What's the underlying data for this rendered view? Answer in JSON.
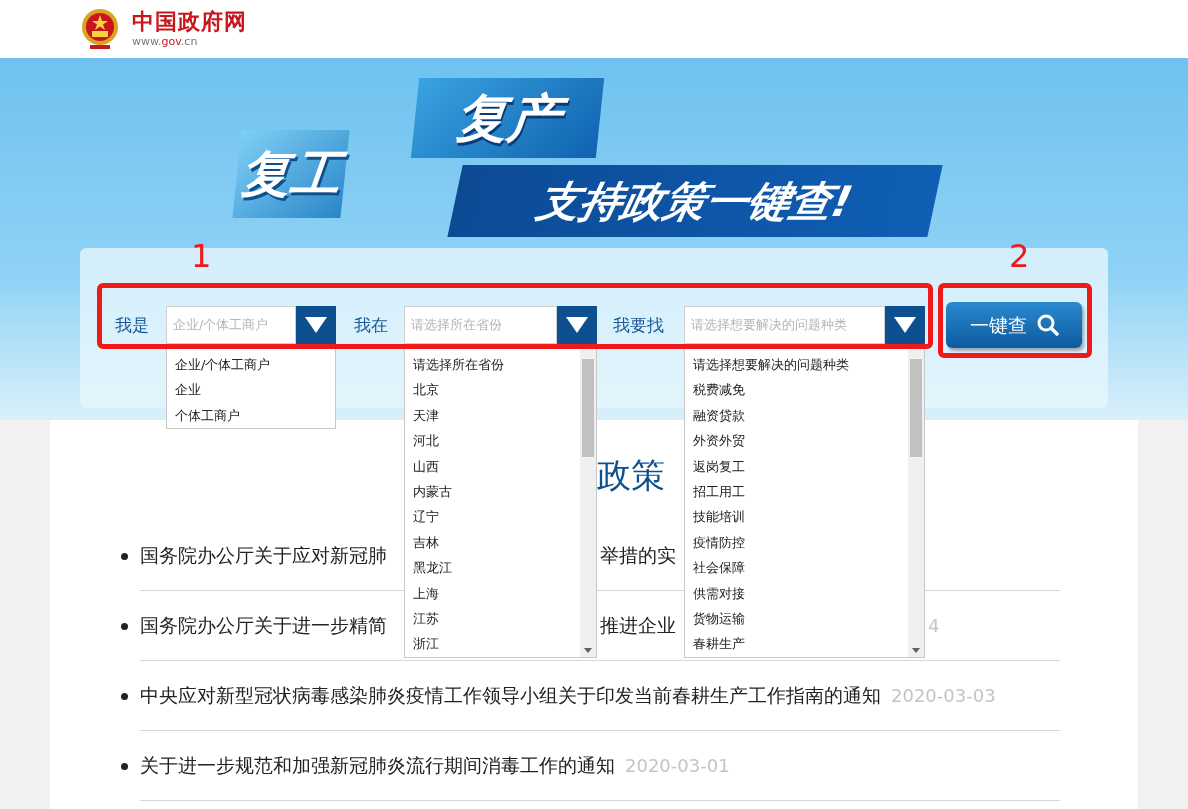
{
  "header": {
    "site_name": "中国政府网",
    "url_prefix": "www.",
    "url_highlight": "gov",
    "url_suffix": ".cn"
  },
  "banner": {
    "tile_1": "复工",
    "tile_2": "复产",
    "slogan": "支持政策一键查!"
  },
  "annotations": [
    "1",
    "2"
  ],
  "search": {
    "fields": [
      {
        "label": "我是",
        "placeholder": "企业/个体工商户",
        "options": [
          "企业/个体工商户",
          "企业",
          "个体工商户"
        ],
        "scrollable": false
      },
      {
        "label": "我在",
        "placeholder": "请选择所在省份",
        "options": [
          "请选择所在省份",
          "北京",
          "天津",
          "河北",
          "山西",
          "内蒙古",
          "辽宁",
          "吉林",
          "黑龙江",
          "上海",
          "江苏",
          "浙江"
        ],
        "scrollable": true
      },
      {
        "label": "我要找",
        "placeholder": "请选择想要解决的问题种类",
        "options": [
          "请选择想要解决的问题种类",
          "税费减免",
          "融资贷款",
          "外资外贸",
          "返岗复工",
          "招工用工",
          "技能培训",
          "疫情防控",
          "社会保障",
          "供需对接",
          "货物运输",
          "春耕生产"
        ],
        "scrollable": true
      }
    ],
    "button": "一键查"
  },
  "section_heading": "政策",
  "news": [
    {
      "text": "国务院办公厅关于应对新冠肺",
      "text_2": "举措的实"
    },
    {
      "text": "国务院办公厅关于进一步精简",
      "text_2": "推进企业",
      "date": "4"
    },
    {
      "text": "中央应对新型冠状病毒感染肺炎疫情工作领导小组关于印发当前春耕生产工作指南的通知",
      "date": "2020-03-03"
    },
    {
      "text": "关于进一步规范和加强新冠肺炎流行期间消毒工作的通知",
      "date": "2020-03-01"
    }
  ]
}
